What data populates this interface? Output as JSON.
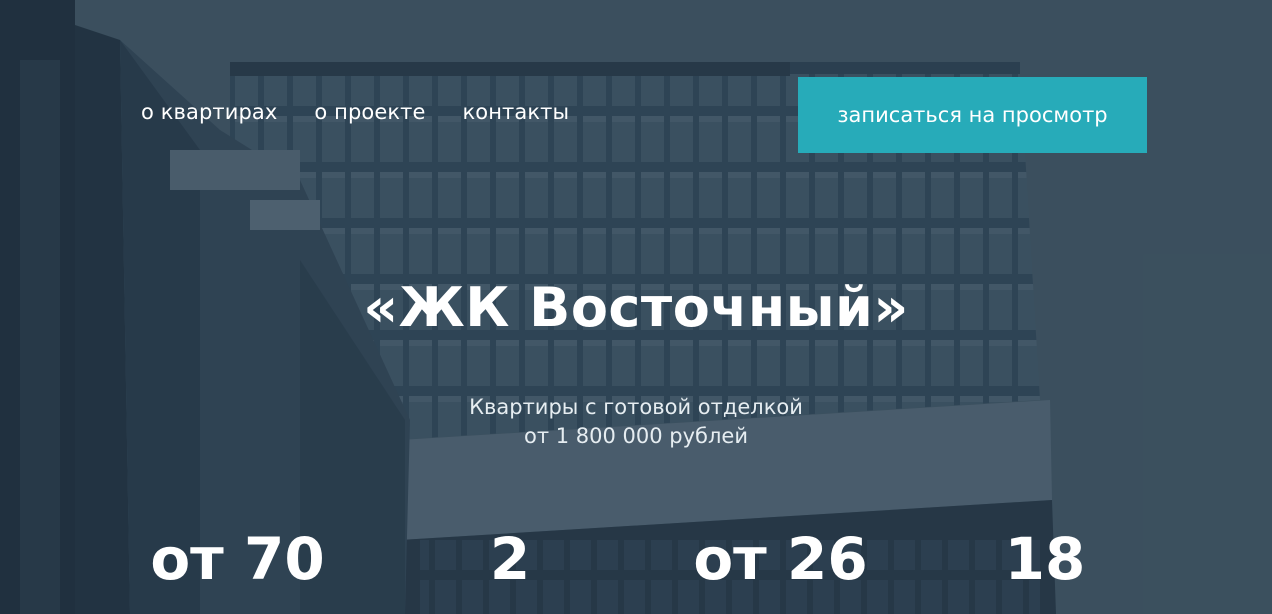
{
  "nav": {
    "items": [
      {
        "label": "о квартирах"
      },
      {
        "label": "о проекте"
      },
      {
        "label": "контакты"
      }
    ]
  },
  "cta": {
    "label": "записаться на просмотр"
  },
  "hero": {
    "title": "«ЖК Восточный»",
    "subtitle_line1": "Квартиры с готовой отделкой",
    "subtitle_line2": "от 1 800 000 рублей"
  },
  "stats": [
    {
      "value": "от 70"
    },
    {
      "value": "2"
    },
    {
      "value": "от 26"
    },
    {
      "value": "18"
    }
  ],
  "colors": {
    "accent": "#27abb9",
    "overlay": "#2f4454",
    "text": "#ffffff"
  },
  "icons": {
    "background": "building-photo"
  }
}
